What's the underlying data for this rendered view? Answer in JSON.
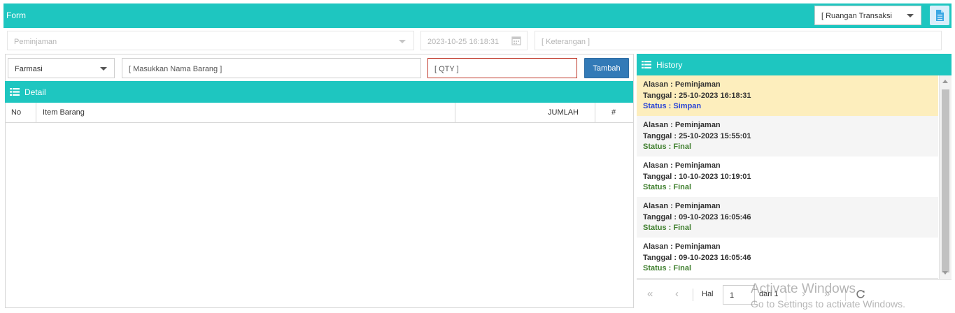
{
  "form": {
    "title": "Form",
    "ruangan_select": "[ Ruangan Transaksi"
  },
  "header_fields": {
    "alasan": "Peminjaman",
    "tanggal": "2023-10-25 16:18:31",
    "keterangan_placeholder": "[ Keterangan ]"
  },
  "input_row": {
    "kategori": "Farmasi",
    "nama_barang_placeholder": "[ Masukkan Nama Barang ]",
    "qty_placeholder": "[ QTY ]",
    "tambah_label": "Tambah"
  },
  "detail": {
    "title": "Detail",
    "columns": [
      "No",
      "Item Barang",
      "JUMLAH",
      "#"
    ]
  },
  "history": {
    "title": "History",
    "items": [
      {
        "alasan": "Alasan : Peminjaman",
        "tanggal": "Tanggal : 25-10-2023 16:18:31",
        "status": "Status : Simpan"
      },
      {
        "alasan": "Alasan : Peminjaman",
        "tanggal": "Tanggal : 25-10-2023 15:55:01",
        "status": "Status : Final"
      },
      {
        "alasan": "Alasan : Peminjaman",
        "tanggal": "Tanggal : 10-10-2023 10:19:01",
        "status": "Status : Final"
      },
      {
        "alasan": "Alasan : Peminjaman",
        "tanggal": "Tanggal : 09-10-2023 16:05:46",
        "status": "Status : Final"
      },
      {
        "alasan": "Alasan : Peminjaman",
        "tanggal": "Tanggal : 09-10-2023 16:05:46",
        "status": "Status : Final"
      }
    ]
  },
  "pager": {
    "hal_label": "Hal",
    "page_value": "1",
    "dari_label": "dari 1"
  },
  "watermark": {
    "line1": "Activate Windows",
    "line2": "Go to Settings to activate Windows."
  },
  "colors": {
    "teal": "#1ec6c0",
    "button_blue": "#337ab7",
    "selected_row": "#fdeebd",
    "status_simpan": "#2a44d6",
    "status_final": "#3f7f2e"
  },
  "icons": {
    "doc_button": "file-icon",
    "calendar": "calendar-icon",
    "detail_bar": "list-icon",
    "history_bar": "list-icon",
    "pager": [
      "first-page-icon",
      "prev-page-icon",
      "next-page-icon",
      "last-page-icon",
      "refresh-icon"
    ]
  }
}
